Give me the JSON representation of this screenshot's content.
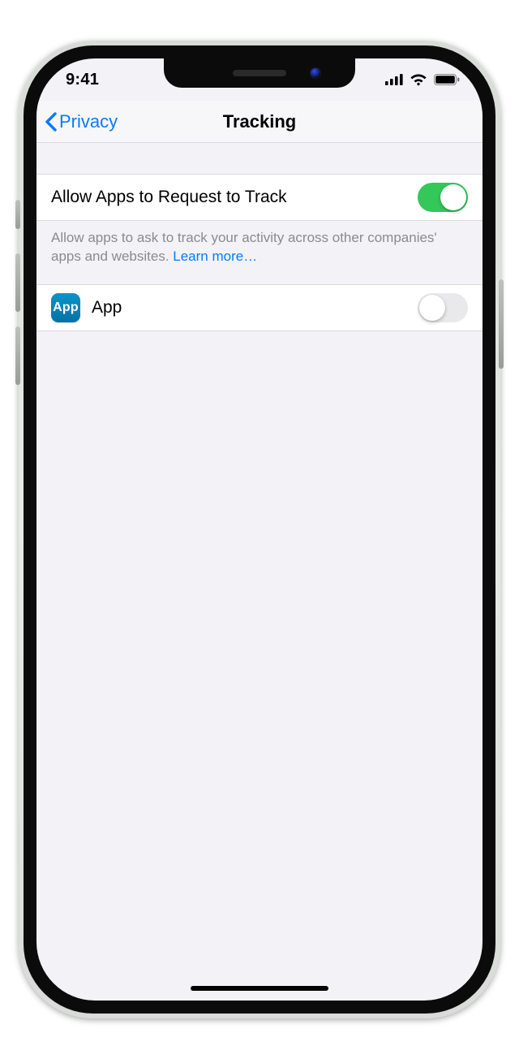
{
  "status": {
    "time": "9:41"
  },
  "nav": {
    "back_label": "Privacy",
    "title": "Tracking"
  },
  "main": {
    "allow_label": "Allow Apps to Request to Track",
    "allow_on": true,
    "footer_text": "Allow apps to ask to track your activity across other companies' apps and websites. ",
    "footer_link": "Learn more…"
  },
  "apps": [
    {
      "name": "App",
      "icon_text": "App",
      "on": false
    }
  ]
}
